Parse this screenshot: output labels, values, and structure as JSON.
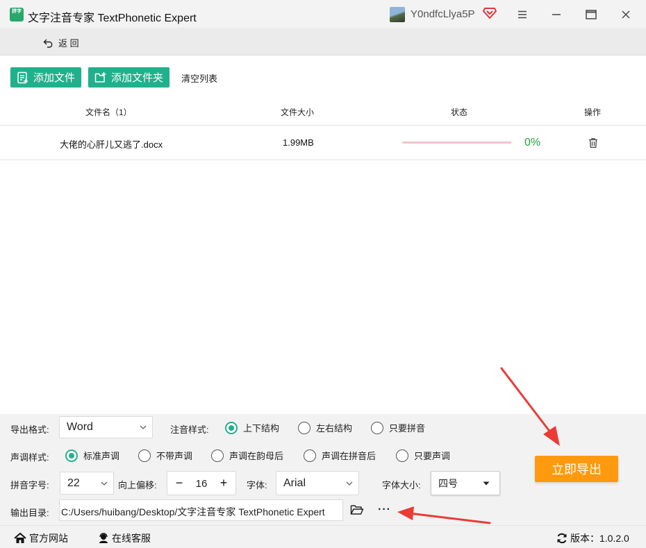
{
  "titlebar": {
    "app_title": "文字注音专家 TextPhonetic Expert",
    "logo_text": "拼字",
    "user_name": "Y0ndfcLlya5P"
  },
  "backbar": {
    "back_label": "返 回"
  },
  "toolbar": {
    "add_file": "添加文件",
    "add_folder": "添加文件夹",
    "clear_list": "清空列表"
  },
  "table": {
    "headers": {
      "name": "文件名（1）",
      "size": "文件大小",
      "status": "状态",
      "action": "操作"
    },
    "rows": [
      {
        "name": "大佬的心肝儿又逃了.docx",
        "size": "1.99MB",
        "progress": 0,
        "progress_text": "0%"
      }
    ]
  },
  "settings": {
    "export_format": {
      "label": "导出格式:",
      "value": "Word"
    },
    "phonetic_style": {
      "label": "注音样式:",
      "options": [
        "上下结构",
        "左右结构",
        "只要拼音"
      ],
      "selected": 0
    },
    "tone_style": {
      "label": "声调样式:",
      "options": [
        "标准声调",
        "不带声调",
        "声调在韵母后",
        "声调在拼音后",
        "只要声调"
      ],
      "selected": 0
    },
    "pinyin_size": {
      "label": "拼音字号:",
      "value": "22"
    },
    "offset": {
      "label": "向上偏移:",
      "value": "16",
      "minus": "−",
      "plus": "+"
    },
    "font": {
      "label": "字体:",
      "value": "Arial"
    },
    "font_size": {
      "label": "字体大小:",
      "value": "四号"
    },
    "output_dir": {
      "label": "输出目录:",
      "value": "C:/Users/huibang/Desktop/文字注音专家 TextPhonetic Expert",
      "more": "···"
    },
    "export_button": "立即导出"
  },
  "footer": {
    "website": "官方网站",
    "support": "在线客服",
    "version": "版本：1.0.2.0"
  },
  "colors": {
    "accent": "#21b08c",
    "export": "#ff9a0e",
    "arrow": "#ea3b35",
    "percent": "#27a13d",
    "vip": "#e8333b"
  }
}
